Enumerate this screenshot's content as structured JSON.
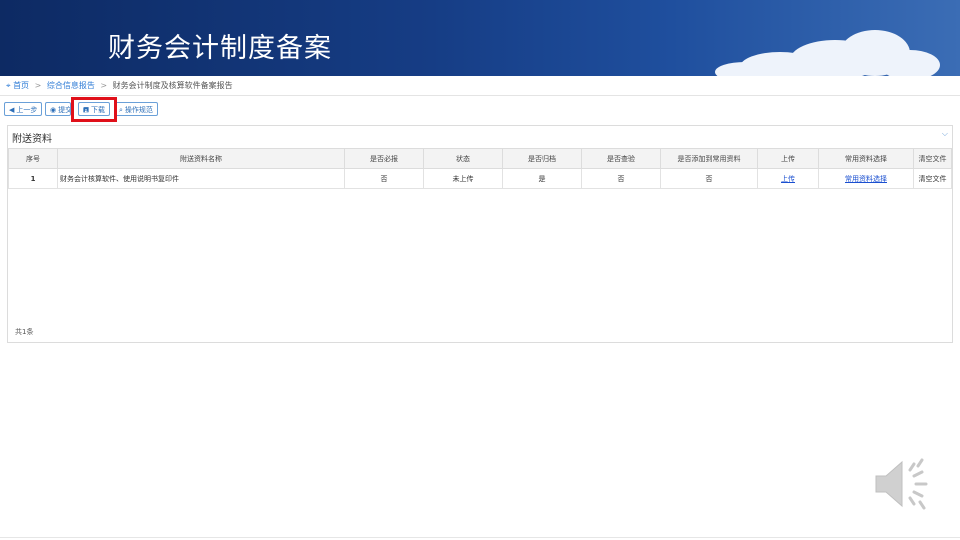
{
  "slide": {
    "title": "财务会计制度备案"
  },
  "breadcrumb": {
    "items": [
      "首页",
      "综合信息报告",
      "财务会计制度及核算软件备案报告"
    ],
    "separator": ">"
  },
  "toolbar": {
    "buttons": [
      {
        "label": "上一步",
        "icon": "arrow-left-icon"
      },
      {
        "label": "提交",
        "icon": "check-circle-icon"
      },
      {
        "label": "下载",
        "icon": "save-icon"
      },
      {
        "label": "操作规范",
        "icon": "search-doc-icon"
      }
    ]
  },
  "panel": {
    "title": "附送资料",
    "columns": [
      "序号",
      "附送资料名称",
      "是否必报",
      "状态",
      "是否归档",
      "是否查验",
      "是否添加到常用资料",
      "上传",
      "常用资料选择",
      "清空文件"
    ],
    "rows": [
      [
        "1",
        "财务会计核算软件、使用说明书复印件",
        "否",
        "未上传",
        "是",
        "否",
        "否",
        "上传",
        "常用资料选择",
        "清空文件"
      ]
    ],
    "total": "共1条"
  },
  "colors": {
    "banner": "#163d85",
    "accent": "#2d7bd6",
    "highlight": "#e0101a",
    "link": "#1a4fd0"
  },
  "icons": {
    "speaker": "speaker-icon",
    "chevron": "chevron-down-icon",
    "pin": "location-pin-icon"
  }
}
